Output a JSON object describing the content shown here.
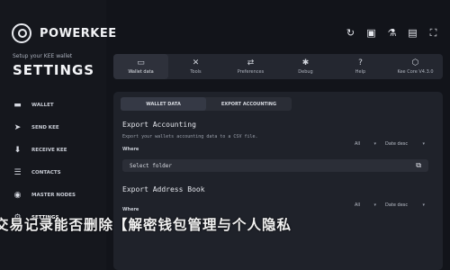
{
  "brand": {
    "name": "POWERKEE"
  },
  "sidebar": {
    "setup_text": "Setup your KEE wallet",
    "title": "SETTINGS",
    "items": [
      {
        "label": "WALLET",
        "icon": "wallet-icon"
      },
      {
        "label": "SEND KEE",
        "icon": "send-icon"
      },
      {
        "label": "RECEIVE KEE",
        "icon": "receive-icon"
      },
      {
        "label": "CONTACTS",
        "icon": "contacts-icon"
      },
      {
        "label": "MASTER NODES",
        "icon": "nodes-icon"
      },
      {
        "label": "SETTINGS",
        "icon": "gear-icon"
      }
    ]
  },
  "topbar_icons": [
    "sync-icon",
    "lock-icon",
    "flask-icon",
    "console-icon",
    "fullscreen-icon"
  ],
  "tabs": [
    {
      "label": "Wallet data",
      "icon": "wallet-data-icon"
    },
    {
      "label": "Tools",
      "icon": "tools-icon"
    },
    {
      "label": "Preferences",
      "icon": "preferences-icon"
    },
    {
      "label": "Debug",
      "icon": "debug-icon"
    },
    {
      "label": "Help",
      "icon": "help-icon"
    },
    {
      "label": "Kee Core V4.3.0",
      "icon": "core-icon"
    }
  ],
  "subtabs": [
    "WALLET DATA",
    "EXPORT ACCOUNTING"
  ],
  "export_accounting": {
    "title": "Export Accounting",
    "description": "Export your wallets accounting data to a CSV file.",
    "where_label": "Where",
    "filter": "All",
    "sort": "Date desc",
    "folder_placeholder": "Select folder"
  },
  "export_address_book": {
    "title": "Export Address Book",
    "where_label": "Where",
    "filter": "All",
    "sort": "Date desc"
  },
  "banner": {
    "text": "交易记录能否删除【解密钱包管理与个人隐私"
  }
}
